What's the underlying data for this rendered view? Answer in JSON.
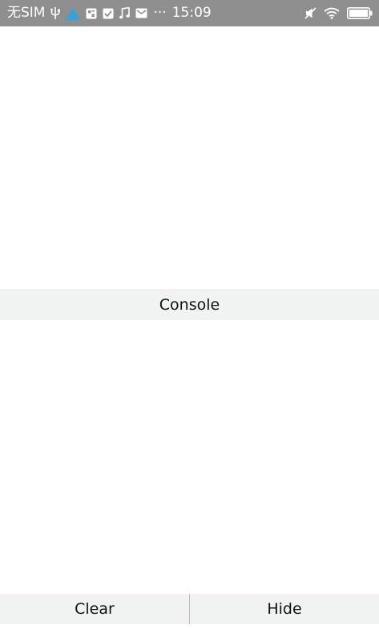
{
  "status_bar": {
    "carrier": "无SIM",
    "more": "···",
    "time": "15:09",
    "background_color": "#8f8f8f",
    "accent_color": "#3aa0d8",
    "icons_left": [
      "usb-icon",
      "warning-triangle-icon",
      "app-notification-icon",
      "checkbox-icon",
      "music-note-icon",
      "mail-icon"
    ],
    "icons_right": [
      "mute-icon",
      "wifi-icon",
      "battery-icon"
    ]
  },
  "console": {
    "title": "Console"
  },
  "bottom_bar": {
    "clear_label": "Clear",
    "hide_label": "Hide"
  }
}
